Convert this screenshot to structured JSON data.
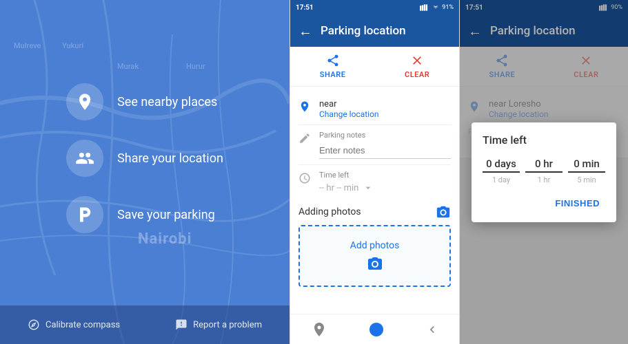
{
  "panel1": {
    "options": [
      {
        "id": "nearby",
        "label": "See nearby places",
        "icon": "location"
      },
      {
        "id": "share",
        "label": "Share your location",
        "icon": "person"
      },
      {
        "id": "parking",
        "label": "Save your parking",
        "icon": "parking"
      }
    ],
    "bottom": [
      {
        "id": "compass",
        "label": "Calibrate compass"
      },
      {
        "id": "problem",
        "label": "Report a problem"
      }
    ],
    "nairobi": "Nairobi",
    "map_labels": [
      "Mulreve",
      "Yukuri",
      "Murak",
      "Hurur"
    ]
  },
  "panel2": {
    "status": {
      "time": "17:51",
      "battery": "91%"
    },
    "header": {
      "title": "Parking location",
      "back": "←"
    },
    "actions": {
      "share": "SHARE",
      "clear": "CLEAR"
    },
    "location": {
      "near": "near",
      "change": "Change location"
    },
    "notes": {
      "label": "Parking notes",
      "placeholder": "Enter notes"
    },
    "time": {
      "label": "Time left",
      "display": "-- hr -- min"
    },
    "photos": {
      "title": "Adding photos",
      "add": "Add photos"
    }
  },
  "panel3": {
    "status": {
      "time": "17:51",
      "battery": "90%"
    },
    "header": {
      "title": "Parking location",
      "back": "←"
    },
    "actions": {
      "share": "SHARE",
      "clear": "CLEAR"
    },
    "location": {
      "near": "near Loresho",
      "change": "Change location"
    },
    "dialog": {
      "title": "Time left",
      "days": {
        "value": "0 days",
        "sub": "1 day"
      },
      "hours": {
        "value": "0 hr",
        "sub": "1 hr"
      },
      "minutes": {
        "value": "0 min",
        "sub": "5 min"
      },
      "finished": "FINISHED"
    }
  }
}
